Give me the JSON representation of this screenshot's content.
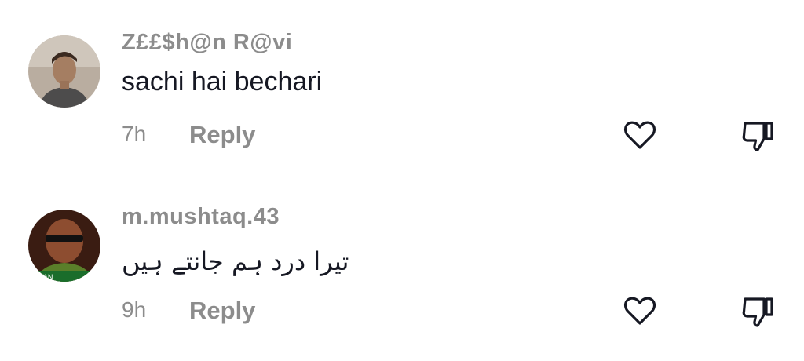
{
  "comments": [
    {
      "username": "Z££$h@n R@vi",
      "text": "sachi hai bechari",
      "time": "7h",
      "reply_label": "Reply",
      "text_direction": "ltr",
      "avatar_tone": "#9a8a78"
    },
    {
      "username": "m.mushtaq.43",
      "text": "تیرا درد ہم جانتے ہیں",
      "time": "9h",
      "reply_label": "Reply",
      "text_direction": "rtl",
      "avatar_tone": "#5a2a1a"
    }
  ],
  "icons": {
    "like": "heart-outline-icon",
    "dislike": "thumbs-down-outline-icon"
  },
  "colors": {
    "meta_gray": "#8c8c8c",
    "text_dark": "#161823",
    "icon_dark": "#161823"
  }
}
